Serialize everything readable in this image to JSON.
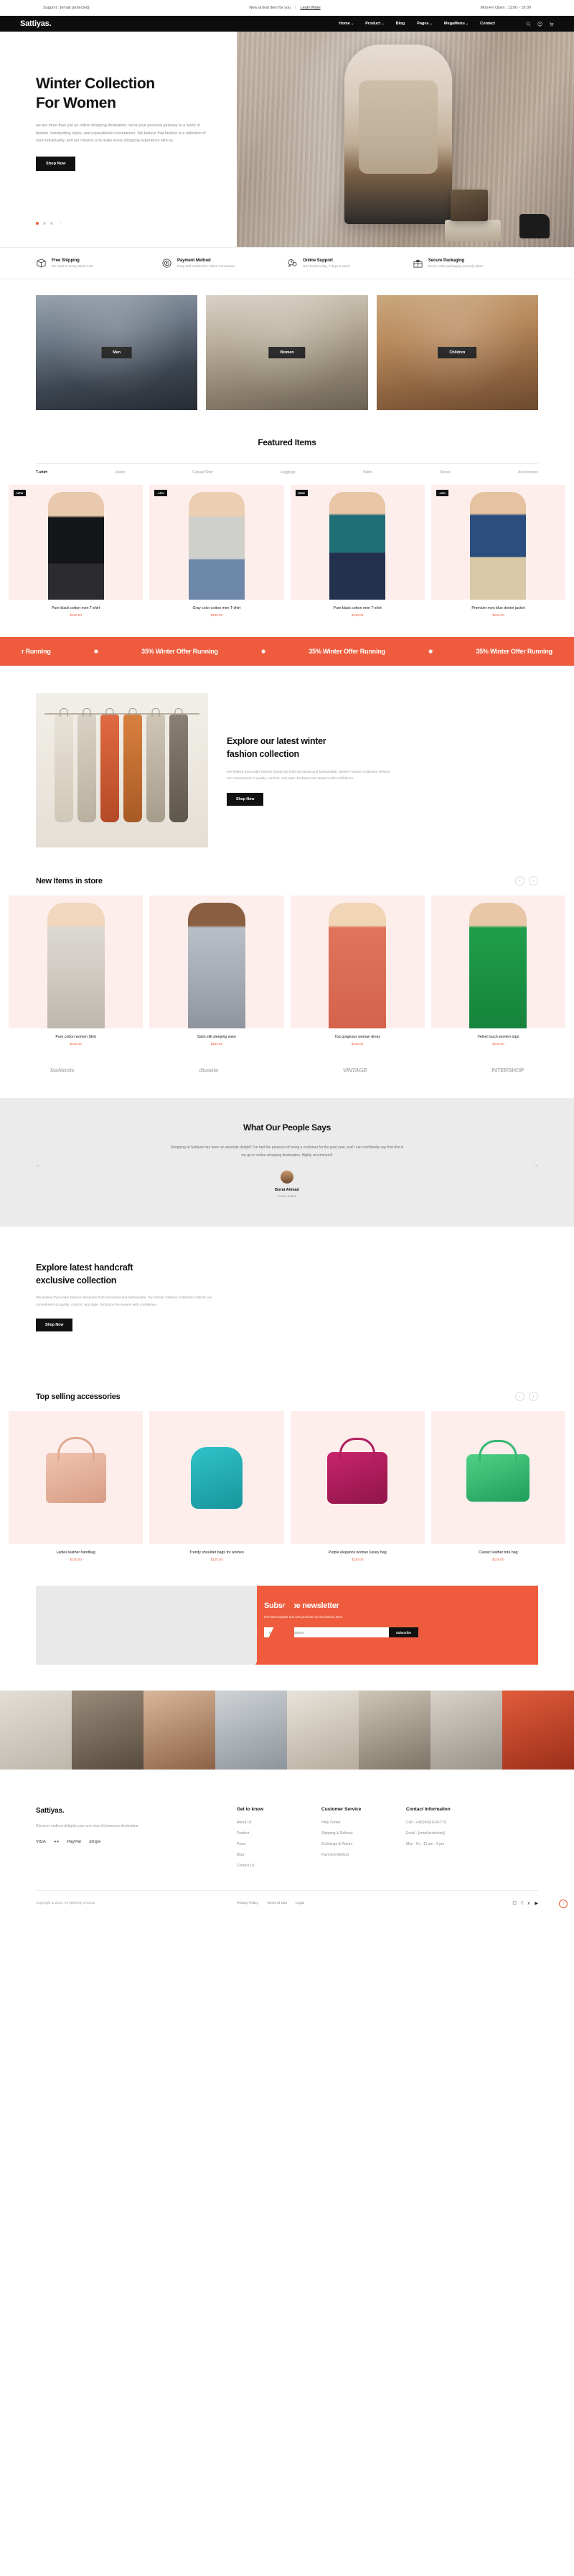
{
  "topbar": {
    "support": "Support : [email protected]",
    "announcement": "New arrival item for you",
    "separator": "|",
    "learn_more": "Learn More",
    "hours": "Mon-Fri Open : 11:00 - 19:00"
  },
  "nav": {
    "logo": "Sattiyas.",
    "items": [
      {
        "label": "Home",
        "caret": "˅"
      },
      {
        "label": "Product",
        "caret": "˅"
      },
      {
        "label": "Blog",
        "caret": ""
      },
      {
        "label": "Pages",
        "caret": "˅"
      },
      {
        "label": "MegaMenu",
        "caret": "˅"
      },
      {
        "label": "Contact",
        "caret": ""
      }
    ],
    "icons": [
      "search-icon",
      "user-icon",
      "cart-icon"
    ]
  },
  "hero": {
    "title_line1": "Winter Collection",
    "title_line2": "For Women",
    "paragraph": "we are more than just an online shopping destination; we're your personal gateway to a world of fashion, trendsetting styles, and unparalleled convenience. We believe that fashion is a reflection of your individuality, and our mission is to make every shopping experience with us.",
    "cta": "Shop Now",
    "arrow": "›"
  },
  "features": [
    {
      "icon": "box-shipping-icon",
      "title": "Free Shipping",
      "subtitle": "No need to worry about cost"
    },
    {
      "icon": "payment-coin-icon",
      "title": "Payment Method",
      "subtitle": "Easy and hassle free online transaction"
    },
    {
      "icon": "chat-support-icon",
      "title": "Online Support",
      "subtitle": "N24 hours a day, 7 days a week"
    },
    {
      "icon": "gift-box-icon",
      "title": "Secure Packaging",
      "subtitle": "Every order packaging securely place"
    }
  ],
  "categories": [
    {
      "label": "Men",
      "theme": "cat1"
    },
    {
      "label": "Women",
      "theme": "cat2"
    },
    {
      "label": "Children",
      "theme": "cat3"
    }
  ],
  "featured": {
    "title": "Featured Items",
    "tabs": [
      {
        "label": "T-shirt",
        "active": true
      },
      {
        "label": "Jeans",
        "active": false
      },
      {
        "label": "Casual Shirt",
        "active": false
      },
      {
        "label": "Leggings",
        "active": false
      },
      {
        "label": "Skirts",
        "active": false
      },
      {
        "label": "Shoes",
        "active": false
      },
      {
        "label": "Accessories",
        "active": false
      }
    ],
    "products": [
      {
        "badge": "NEW",
        "name": "Pure black cotton men T-shirt",
        "price": "$130.00",
        "fig": "pf-black"
      },
      {
        "badge": "-15%",
        "name": "Gray color cotton men T-shirt",
        "price": "$130.00",
        "fig": "pf-gray"
      },
      {
        "badge": "NEW",
        "name": "Pure black cotton men T-shirt",
        "price": "$130.00",
        "fig": "pf-teal"
      },
      {
        "badge": "-15%",
        "name": "Premium men blue denim jacket",
        "price": "$160.00",
        "fig": "pf-denim"
      }
    ]
  },
  "marquee": {
    "text": "35% Winter Offer Running",
    "star": "✸",
    "items": [
      "r Running",
      "35% Winter Offer Running",
      "35% Winter Offer Running",
      "35% Winter Offer Running"
    ]
  },
  "explore": {
    "title_line1": "Explore our latest winter",
    "title_line2": "fashion collection",
    "paragraph": "We believe that under fashion should be both functional and fashionable. Winter Fashion Collection reflects our commitment to quality, comfort, and style. Embrace the season with confidence.",
    "cta": "Shop Now"
  },
  "new_items": {
    "title": "New Items in store",
    "prev": "‹",
    "next": "›",
    "products": [
      {
        "name": "Pure cotton women Skirt",
        "price": "$130.00",
        "fig": "nf-1"
      },
      {
        "name": "Satin silk sleeping ware",
        "price": "$130.00",
        "fig": "nf-2"
      },
      {
        "name": "Top gorgeous woman dress",
        "price": "$130.00",
        "fig": "nf-3"
      },
      {
        "name": "Velvet touch women tops",
        "price": "$130.00",
        "fig": "nf-4"
      }
    ]
  },
  "brands": [
    {
      "label": "fashionts",
      "italic": true
    },
    {
      "label": "divante",
      "italic": false
    },
    {
      "label": "VINTAGE",
      "italic": true
    },
    {
      "label": "INTERSHOP",
      "italic": false
    }
  ],
  "testimonial": {
    "title": "What Our People Says",
    "quote": "Shopping at Sattiyas has been an absolute delight! I've had the pleasure of being a customer for the past year, and I can confidently say that this is my go-to online shopping destination. Highly recommend!",
    "name": "Borat Ahmad",
    "role": "From London",
    "prev": "←",
    "next": "→"
  },
  "craft": {
    "title_line1": "Explore latest handcraft",
    "title_line2": "exclusive collection",
    "paragraph": "We believe that under fashion should be both functional and fashionable. Our Winter Fashion Collection reflects our commitment to quality, comfort, and style. Embrace the season with confidence.",
    "cta": "Shop Now"
  },
  "accessories": {
    "title": "Top selling accessories",
    "prev": "‹",
    "next": "›",
    "products": [
      {
        "name": "Ladies leather handbag",
        "price": "$130.00",
        "fig": "bag1"
      },
      {
        "name": "Trendy shoulder bags for women",
        "price": "$120.00",
        "fig": "bag2"
      },
      {
        "name": "Purple elegance woman luxury bag",
        "price": "$130.00",
        "fig": "bag3"
      },
      {
        "name": "Classic leather tote bag",
        "price": "$130.00",
        "fig": "bag4"
      }
    ]
  },
  "newsletter": {
    "title": "Subscribe newsletter",
    "subtitle": "Get latest update and new products on our fashion store",
    "placeholder": "Enter your email address",
    "button": "Subscribe"
  },
  "footer": {
    "logo": "Sattiyas.",
    "description": "Discover endless delights your one stop eCommerce destination.",
    "payments": [
      "VISA",
      "mastercard-icon",
      "PayPal",
      "stripe"
    ],
    "columns": [
      {
        "title": "Get to know",
        "links": [
          "About Us",
          "Product",
          "Press",
          "Blog",
          "Contact Us"
        ]
      },
      {
        "title": "Customer Service",
        "links": [
          "Help Center",
          "Shipping & Delivery",
          "Exchange & Return",
          "Payment Method"
        ]
      }
    ],
    "contact": {
      "title": "Contact Information",
      "lines": [
        "Call : +00(244)14-50-774",
        "Email : [email protected]",
        "Mon - Fri : 11 am - 9 pm"
      ]
    },
    "copyright": "Copyright & 2023, All rights by 17sucai",
    "bottom_links": [
      "Privacy Policy",
      "Terms of Use",
      "Legal"
    ],
    "socials": [
      "instagram-icon",
      "facebook-icon",
      "x-twitter-icon",
      "youtube-icon"
    ],
    "to_top": "↑"
  }
}
